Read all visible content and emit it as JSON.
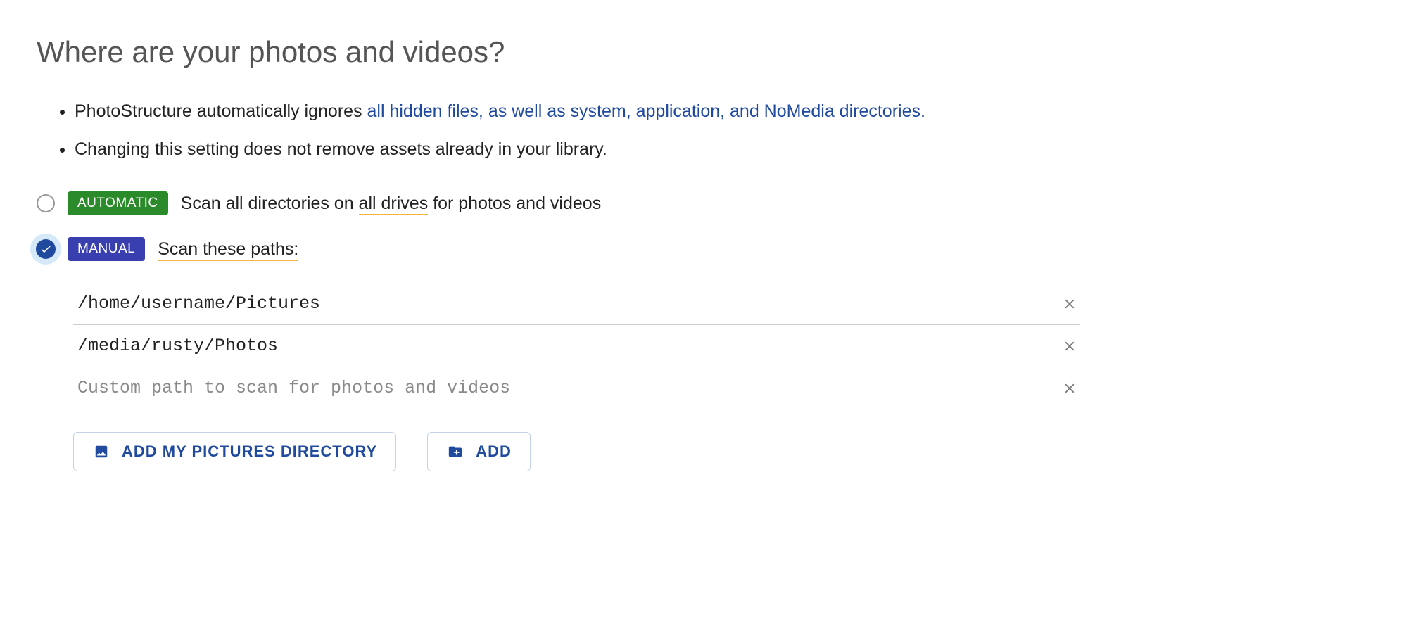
{
  "title": "Where are your photos and videos?",
  "info_items": {
    "a_prefix": "PhotoStructure automatically ignores ",
    "a_link": "all hidden files, as well as system, application, and NoMedia directories.",
    "b": "Changing this setting does not remove assets already in your library."
  },
  "options": {
    "automatic": {
      "badge": "AUTOMATIC",
      "text_before": "Scan all directories on ",
      "text_underlined": "all drives",
      "text_after": " for photos and videos",
      "selected": false
    },
    "manual": {
      "badge": "MANUAL",
      "text_underlined": "Scan these paths:",
      "selected": true
    }
  },
  "paths": [
    "/home/username/Pictures",
    "/media/rusty/Photos"
  ],
  "paths_placeholder": "Custom path to scan for photos and videos",
  "buttons": {
    "add_pictures_dir": "ADD MY PICTURES DIRECTORY",
    "add": "ADD"
  }
}
